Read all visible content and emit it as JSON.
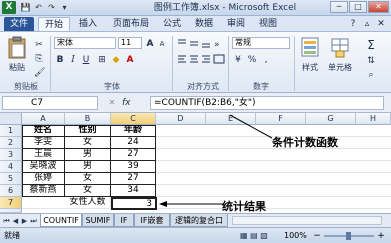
{
  "window": {
    "title": "图例工作簿.xlsx - Microsoft Excel",
    "app_icon_glyph": "X",
    "qa_glyphs": [
      "💾",
      "↶",
      "↷",
      "▾"
    ],
    "min_glyph": "─",
    "max_glyph": "□",
    "close_glyph": "✕"
  },
  "tabs": [
    "文件",
    "开始",
    "插入",
    "页面布局",
    "公式",
    "数据",
    "审阅",
    "视图"
  ],
  "ribbon": {
    "clipboard": {
      "paste_label": "粘贴",
      "group_label": "剪贴板"
    },
    "font": {
      "font_name": "宋体",
      "font_size": "11",
      "bold": "B",
      "italic": "I",
      "underline": "U",
      "grow": "A",
      "shrink": "A",
      "group_label": "字体"
    },
    "alignment": {
      "group_label": "对齐方式"
    },
    "number": {
      "format": "常规",
      "currency": "%",
      "comma": ",",
      "group_label": "数字"
    },
    "styles": {
      "label": "样式"
    },
    "cells": {
      "label": "单元格"
    },
    "editing": {
      "sum": "Σ"
    }
  },
  "formula_bar": {
    "name_box": "C7",
    "fx": "fx",
    "formula": "=COUNTIF(B2:B6,\"女\")"
  },
  "grid": {
    "columns": [
      "A",
      "B",
      "C",
      "D",
      "E",
      "F",
      "G",
      "H"
    ],
    "rows": [
      "1",
      "2",
      "3",
      "4",
      "5",
      "6",
      "7",
      "8"
    ],
    "table": [
      [
        "姓名",
        "性别",
        "年龄"
      ],
      [
        "李雯",
        "女",
        "24"
      ],
      [
        "王晨",
        "男",
        "27"
      ],
      [
        "吴晓波",
        "男",
        "39"
      ],
      [
        "张婷",
        "女",
        "27"
      ],
      [
        "蔡新燕",
        "女",
        "34"
      ]
    ],
    "result_label": "女性人数",
    "result_value": "3"
  },
  "annotations": {
    "formula_note": "条件计数函数",
    "result_note": "统计结果"
  },
  "sheet_tabs": [
    "COUNTIF",
    "SUMIF",
    "IF",
    "IF嵌套",
    "逻辑的复合口"
  ],
  "status": {
    "ready": "就绪",
    "zoom": "100%"
  }
}
